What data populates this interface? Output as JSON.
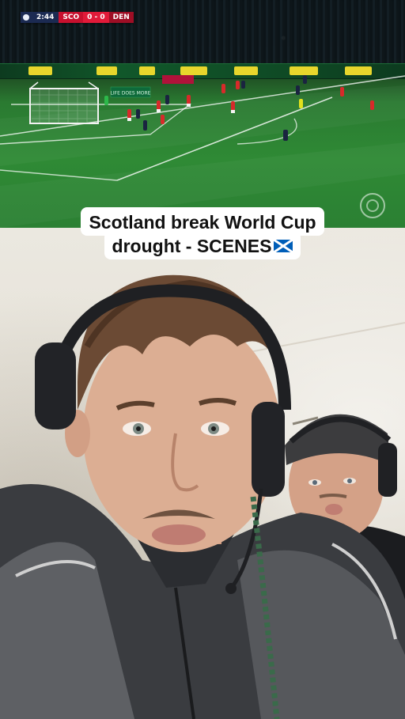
{
  "scoreboard": {
    "clock": "2:44",
    "home_team": "SCO",
    "score": "0 - 0",
    "away_team": "DEN"
  },
  "pitch": {
    "ad_text": "LIFE DOES MORE",
    "crest_icon": "scotland-fa-crest-icon"
  },
  "caption": {
    "line1": "Scotland break World Cup",
    "line2": "drought - SCENES",
    "flag_icon": "scotland-flag-icon"
  },
  "colors": {
    "scoreboard_red": "#c8102e",
    "scoreboard_navy": "#1b2a52",
    "scotland_kit": "#1a2440",
    "denmark_kit": "#d72a2a",
    "flag_blue": "#005eb8"
  }
}
